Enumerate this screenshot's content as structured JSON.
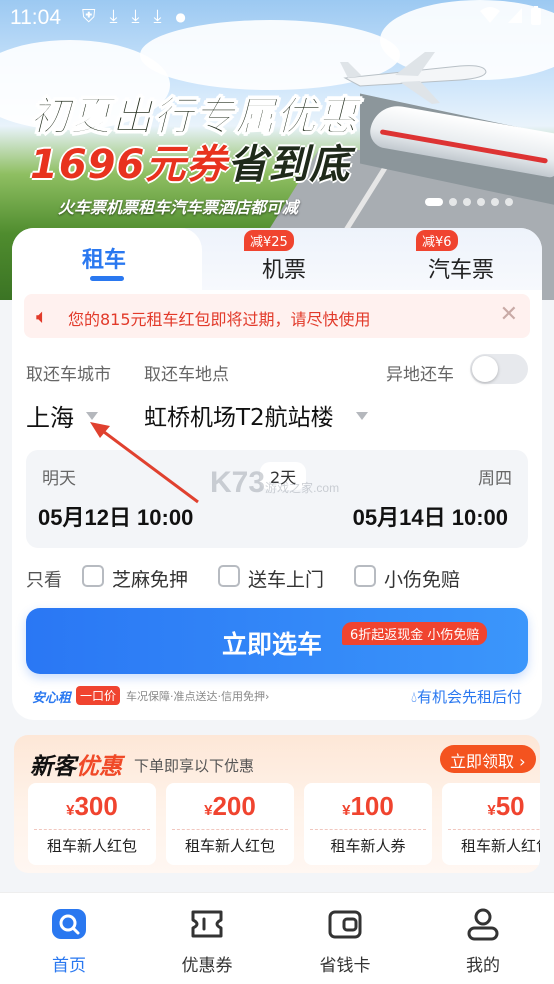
{
  "status_bar": {
    "time": "11:04"
  },
  "banner": {
    "headline": "初夏出行专属优惠",
    "amount": "1696元券",
    "amount_suffix": "省到底",
    "subline": "火车票机票租车汽车票酒店都可减"
  },
  "tabs": [
    {
      "label": "租车",
      "badge": ""
    },
    {
      "label": "机票",
      "badge": "减¥25"
    },
    {
      "label": "汽车票",
      "badge": "减¥6"
    }
  ],
  "notice": {
    "text": "您的815元租车红包即将过期，请尽快使用"
  },
  "labels": {
    "city": "取还车城市",
    "location": "取还车地点",
    "different_return": "异地还车"
  },
  "pickup": {
    "city": "上海",
    "location": "虹桥机场T2航站楼",
    "different_return_enabled": false
  },
  "dates": {
    "start_day": "明天",
    "start": "05月12日 10:00",
    "duration": "2天",
    "end_day": "周四",
    "end": "05月14日 10:00"
  },
  "filters": {
    "label": "只看",
    "options": [
      "芝麻免押",
      "送车上门",
      "小伤免赔"
    ]
  },
  "cta": {
    "label": "立即选车",
    "tag": "6折起返现金 小伤免赔"
  },
  "assurance": {
    "brand": "安心租",
    "badge": "一口价",
    "text": "车况保障·准点送达·信用免押›",
    "right": "有机会先租后付"
  },
  "promo": {
    "title_a": "新客",
    "title_b": "优惠",
    "subtitle": "下单即享以下优惠",
    "claim": "立即领取 ›",
    "coupons": [
      {
        "amount": "300",
        "label": "租车新人红包"
      },
      {
        "amount": "200",
        "label": "租车新人红包"
      },
      {
        "amount": "100",
        "label": "租车新人券"
      },
      {
        "amount": "50",
        "label": "租车新人红包"
      }
    ],
    "currency": "¥"
  },
  "nav": [
    {
      "label": "首页",
      "icon": "home-search-icon"
    },
    {
      "label": "优惠券",
      "icon": "ticket-icon"
    },
    {
      "label": "省钱卡",
      "icon": "wallet-card-icon"
    },
    {
      "label": "我的",
      "icon": "user-icon"
    }
  ],
  "watermark": {
    "main": "K73",
    "sub": "游戏之家",
    "domain": ".com"
  },
  "colors": {
    "accent": "#2a78f0",
    "alert": "#f0442f",
    "orange": "#f4531f"
  }
}
